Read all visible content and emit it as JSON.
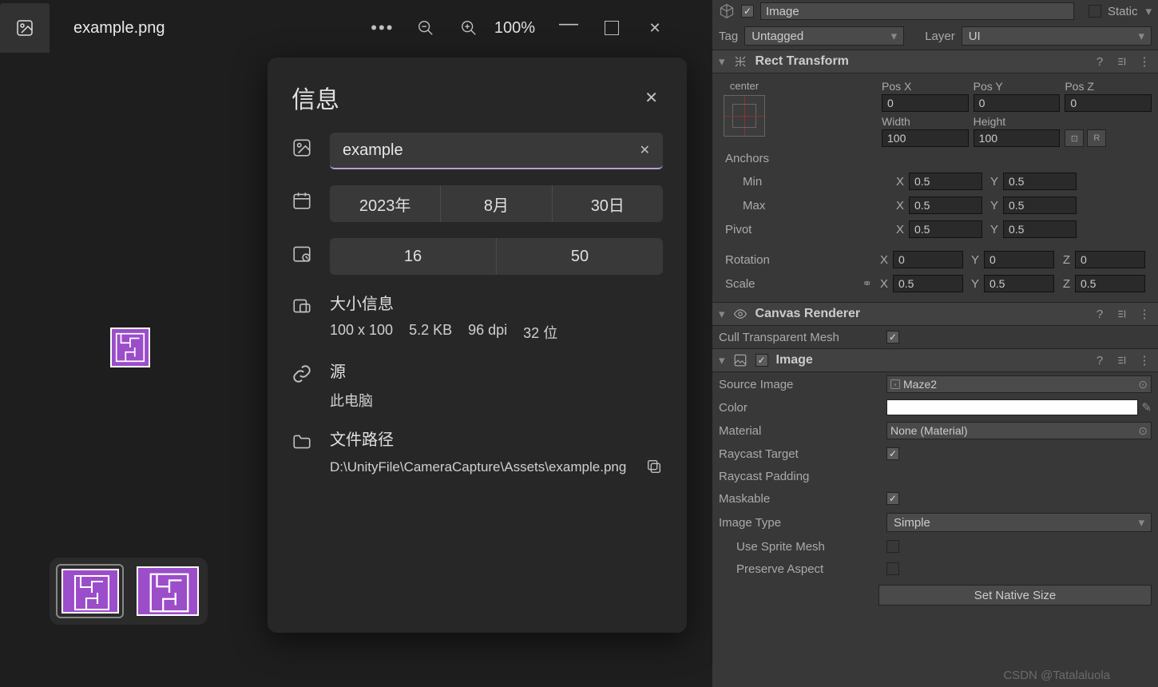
{
  "viewer": {
    "filename": "example.png",
    "zoom": "100%"
  },
  "info": {
    "title": "信息",
    "name": "example",
    "date": {
      "year": "2023年",
      "month": "8月",
      "day": "30日"
    },
    "time": {
      "hour": "16",
      "minute": "50"
    },
    "size_title": "大小信息",
    "dimensions": "100 x 100",
    "filesize": "5.2 KB",
    "dpi": "96 dpi",
    "bits": "32 位",
    "source_title": "源",
    "source_value": "此电脑",
    "path_title": "文件路径",
    "path_value": "D:\\UnityFile\\CameraCapture\\Assets\\example.png"
  },
  "inspector": {
    "object_name": "Image",
    "static_label": "Static",
    "tag_label": "Tag",
    "tag_value": "Untagged",
    "layer_label": "Layer",
    "layer_value": "UI",
    "rect": {
      "title": "Rect Transform",
      "anchor_mode": "center",
      "posx_label": "Pos X",
      "posy_label": "Pos Y",
      "posz_label": "Pos Z",
      "posx": "0",
      "posy": "0",
      "posz": "0",
      "width_label": "Width",
      "height_label": "Height",
      "width": "100",
      "height": "100",
      "anchors_label": "Anchors",
      "min_label": "Min",
      "max_label": "Max",
      "min_x": "0.5",
      "min_y": "0.5",
      "max_x": "0.5",
      "max_y": "0.5",
      "pivot_label": "Pivot",
      "pivot_x": "0.5",
      "pivot_y": "0.5",
      "rotation_label": "Rotation",
      "rot_x": "0",
      "rot_y": "0",
      "rot_z": "0",
      "scale_label": "Scale",
      "scale_x": "0.5",
      "scale_y": "0.5",
      "scale_z": "0.5",
      "blueprint_label": "R"
    },
    "canvas": {
      "title": "Canvas Renderer",
      "cull_label": "Cull Transparent Mesh",
      "cull_checked": true
    },
    "image": {
      "title": "Image",
      "source_label": "Source Image",
      "source_value": "Maze2",
      "color_label": "Color",
      "color_value": "#ffffff",
      "material_label": "Material",
      "material_value": "None (Material)",
      "raycast_label": "Raycast Target",
      "raycast_checked": true,
      "raycast_padding_label": "Raycast Padding",
      "maskable_label": "Maskable",
      "maskable_checked": true,
      "image_type_label": "Image Type",
      "image_type_value": "Simple",
      "use_sprite_mesh_label": "Use Sprite Mesh",
      "preserve_aspect_label": "Preserve Aspect",
      "set_native_label": "Set Native Size"
    }
  },
  "watermark": "CSDN @Tatalaluola"
}
